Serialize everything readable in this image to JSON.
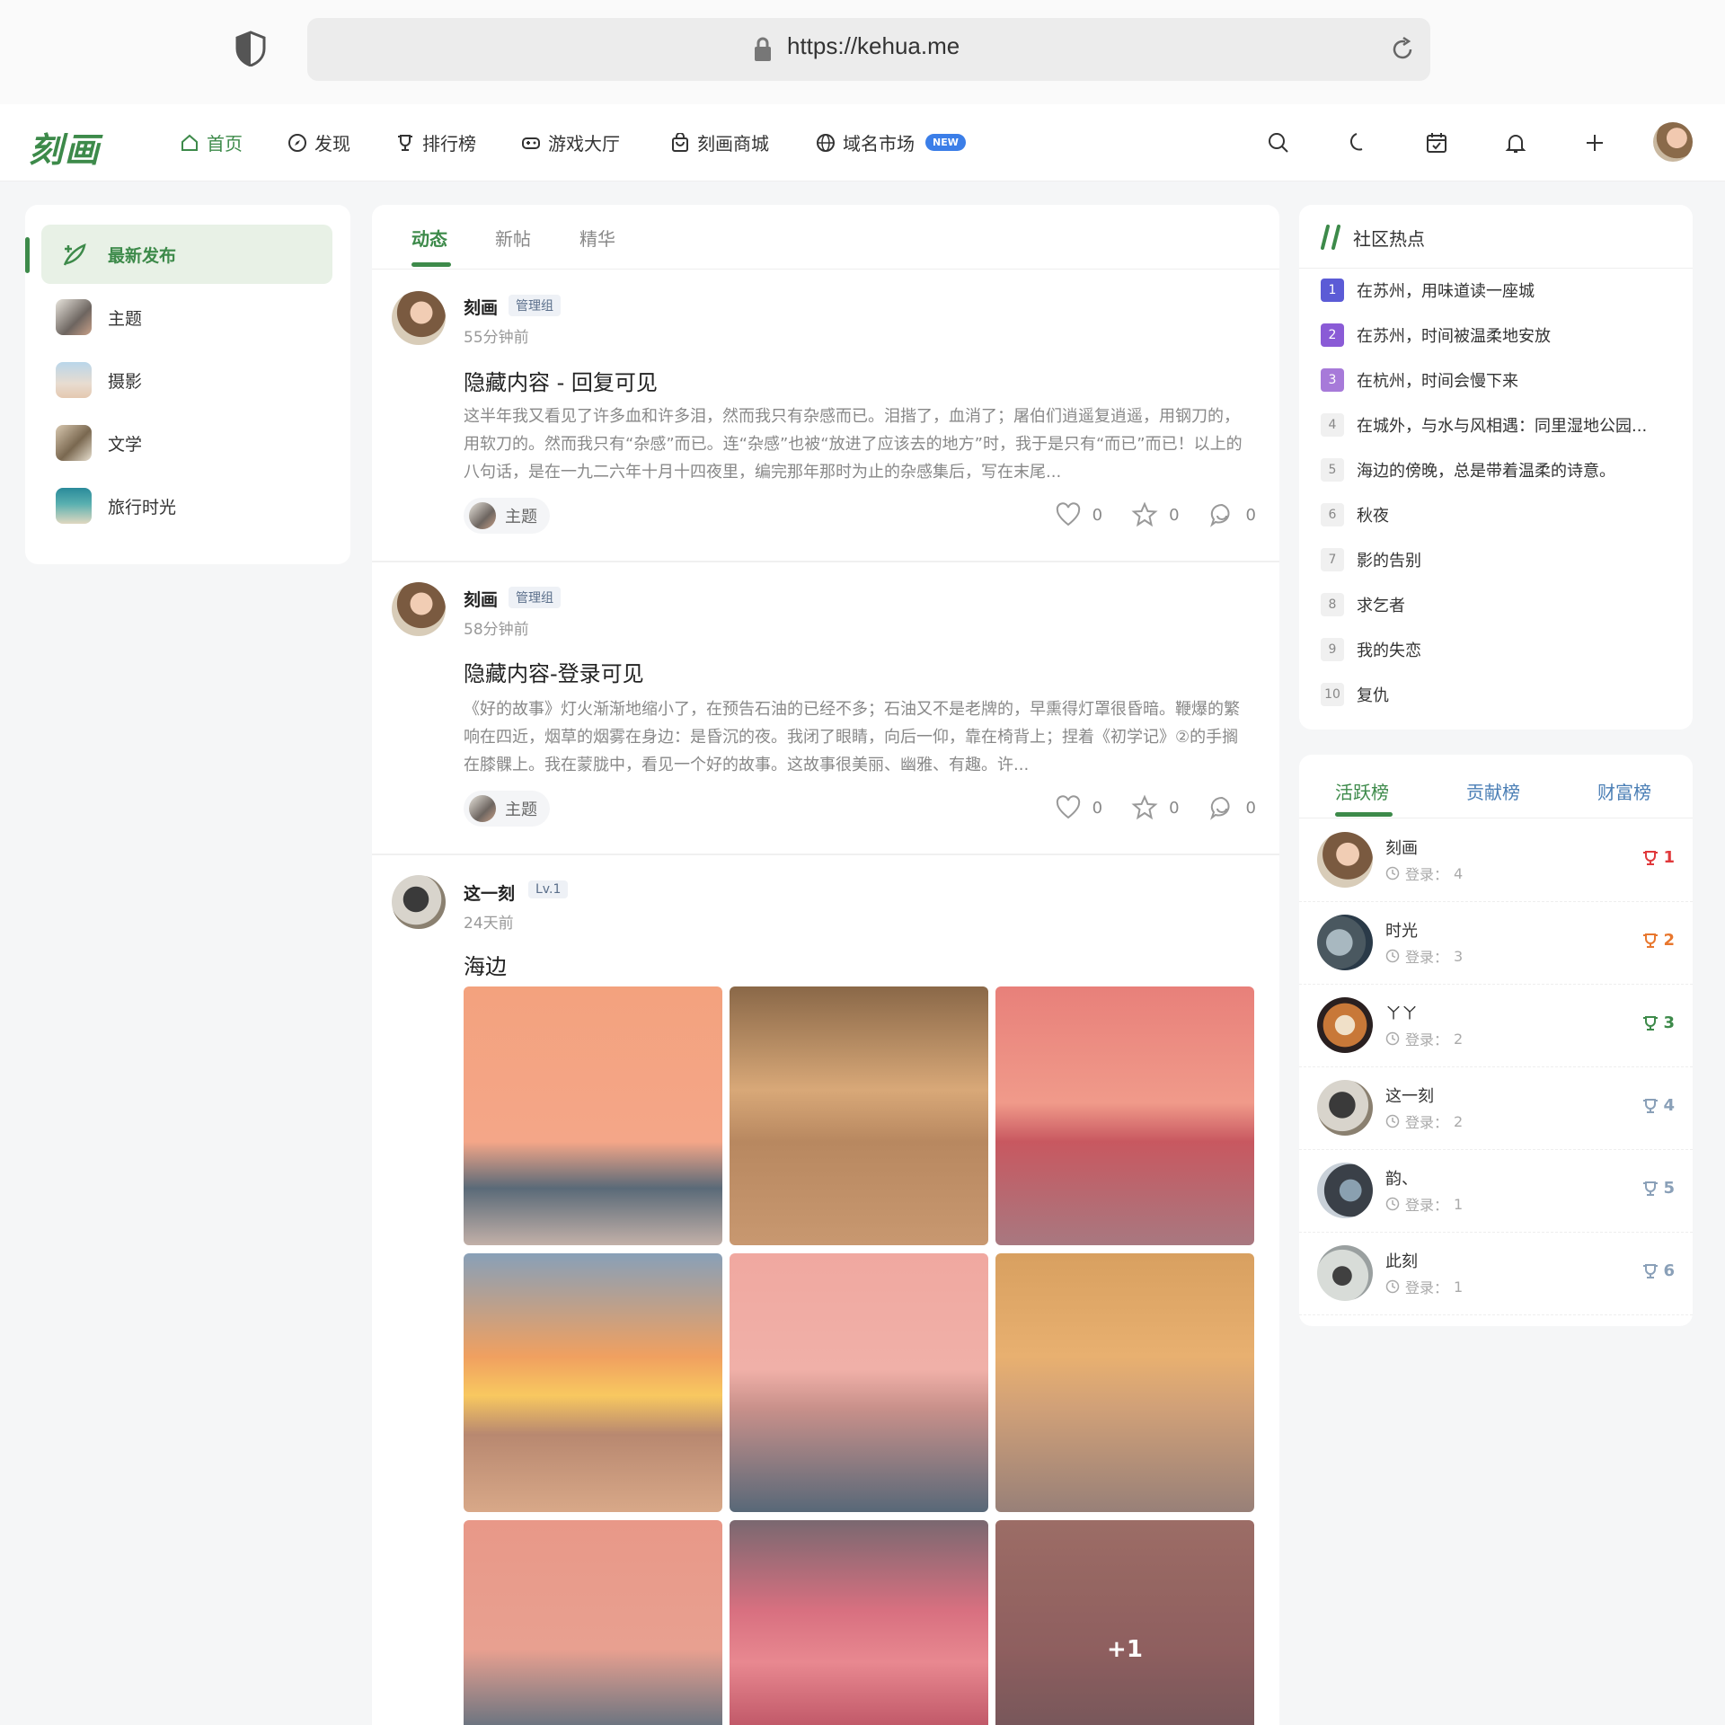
{
  "browser": {
    "url": "https://kehua.me"
  },
  "nav": {
    "logo": "刻画",
    "items": [
      {
        "label": "首页",
        "icon": "home-icon"
      },
      {
        "label": "发现",
        "icon": "compass-icon"
      },
      {
        "label": "排行榜",
        "icon": "trophy-icon"
      },
      {
        "label": "游戏大厅",
        "icon": "gamepad-icon"
      },
      {
        "label": "刻画商城",
        "icon": "shop-bag-icon"
      },
      {
        "label": "域名市场",
        "icon": "globe-icon",
        "badge": "NEW"
      }
    ]
  },
  "sidebar": {
    "items": [
      {
        "label": "最新发布",
        "icon": "sprout-icon"
      },
      {
        "label": "主题"
      },
      {
        "label": "摄影"
      },
      {
        "label": "文学"
      },
      {
        "label": "旅行时光"
      }
    ]
  },
  "feed": {
    "tabs": [
      "动态",
      "新帖",
      "精华"
    ],
    "posts": [
      {
        "author": "刻画",
        "role": "管理组",
        "time": "55分钟前",
        "title": "隐藏内容 - 回复可见",
        "body": "这半年我又看见了许多血和许多泪，然而我只有杂感而已。泪揩了，血消了；屠伯们逍遥复逍遥，用钢刀的，用软刀的。然而我只有“杂感”而已。连“杂感”也被“放进了应该去的地方”时，我于是只有“而已”而已！以上的八句话，是在一九二六年十月十四夜里，编完那年那时为止的杂感集后，写在末尾...",
        "tag": "主题",
        "likes": "0",
        "stars": "0",
        "comments": "0"
      },
      {
        "author": "刻画",
        "role": "管理组",
        "time": "58分钟前",
        "title": "隐藏内容-登录可见",
        "body": "《好的故事》灯火渐渐地缩小了，在预告石油的已经不多；石油又不是老牌的，早熏得灯罩很昏暗。鞭爆的繁响在四近，烟草的烟雾在身边：是昏沉的夜。我闭了眼睛，向后一仰，靠在椅背上；捏着《初学记》②的手搁在膝髁上。我在蒙胧中，看见一个好的故事。这故事很美丽、幽雅、有趣。许...",
        "tag": "主题",
        "likes": "0",
        "stars": "0",
        "comments": "0"
      },
      {
        "author": "这一刻",
        "role": "Lv.1",
        "time": "24天前",
        "title": "海边",
        "more": "+1"
      }
    ]
  },
  "hot": {
    "title": "社区热点",
    "items": [
      {
        "n": "1",
        "text": "在苏州，用味道读一座城",
        "color": "#5b5bd6"
      },
      {
        "n": "2",
        "text": "在苏州，时间被温柔地安放",
        "color": "#8a5bd6"
      },
      {
        "n": "3",
        "text": "在杭州，时间会慢下来",
        "color": "#a77ad9"
      },
      {
        "n": "4",
        "text": "在城外，与水与风相遇：同里湿地公园...",
        "color": "#f0f0f0"
      },
      {
        "n": "5",
        "text": "海边的傍晚，总是带着温柔的诗意。",
        "color": "#f0f0f0"
      },
      {
        "n": "6",
        "text": "秋夜",
        "color": "#f0f0f0"
      },
      {
        "n": "7",
        "text": "影的告别",
        "color": "#f0f0f0"
      },
      {
        "n": "8",
        "text": "求乞者",
        "color": "#f0f0f0"
      },
      {
        "n": "9",
        "text": "我的失恋",
        "color": "#f0f0f0"
      },
      {
        "n": "10",
        "text": "复仇",
        "color": "#f0f0f0"
      }
    ]
  },
  "rank": {
    "tabs": [
      "活跃榜",
      "贡献榜",
      "财富榜"
    ],
    "login_label": "登录：",
    "items": [
      {
        "name": "刻画",
        "login": "4",
        "rank": "1",
        "color": "#e0383b"
      },
      {
        "name": "时光",
        "login": "3",
        "rank": "2",
        "color": "#e8772e"
      },
      {
        "name": "ㄚㄚ",
        "login": "2",
        "rank": "3",
        "color": "#3d8a4a"
      },
      {
        "name": "这一刻",
        "login": "2",
        "rank": "4",
        "color": "#8aa0b8"
      },
      {
        "name": "韵、",
        "login": "1",
        "rank": "5",
        "color": "#8aa0b8"
      },
      {
        "name": "此刻",
        "login": "1",
        "rank": "6",
        "color": "#8aa0b8"
      }
    ]
  },
  "colors": {
    "brand": "#3d8a4a"
  }
}
